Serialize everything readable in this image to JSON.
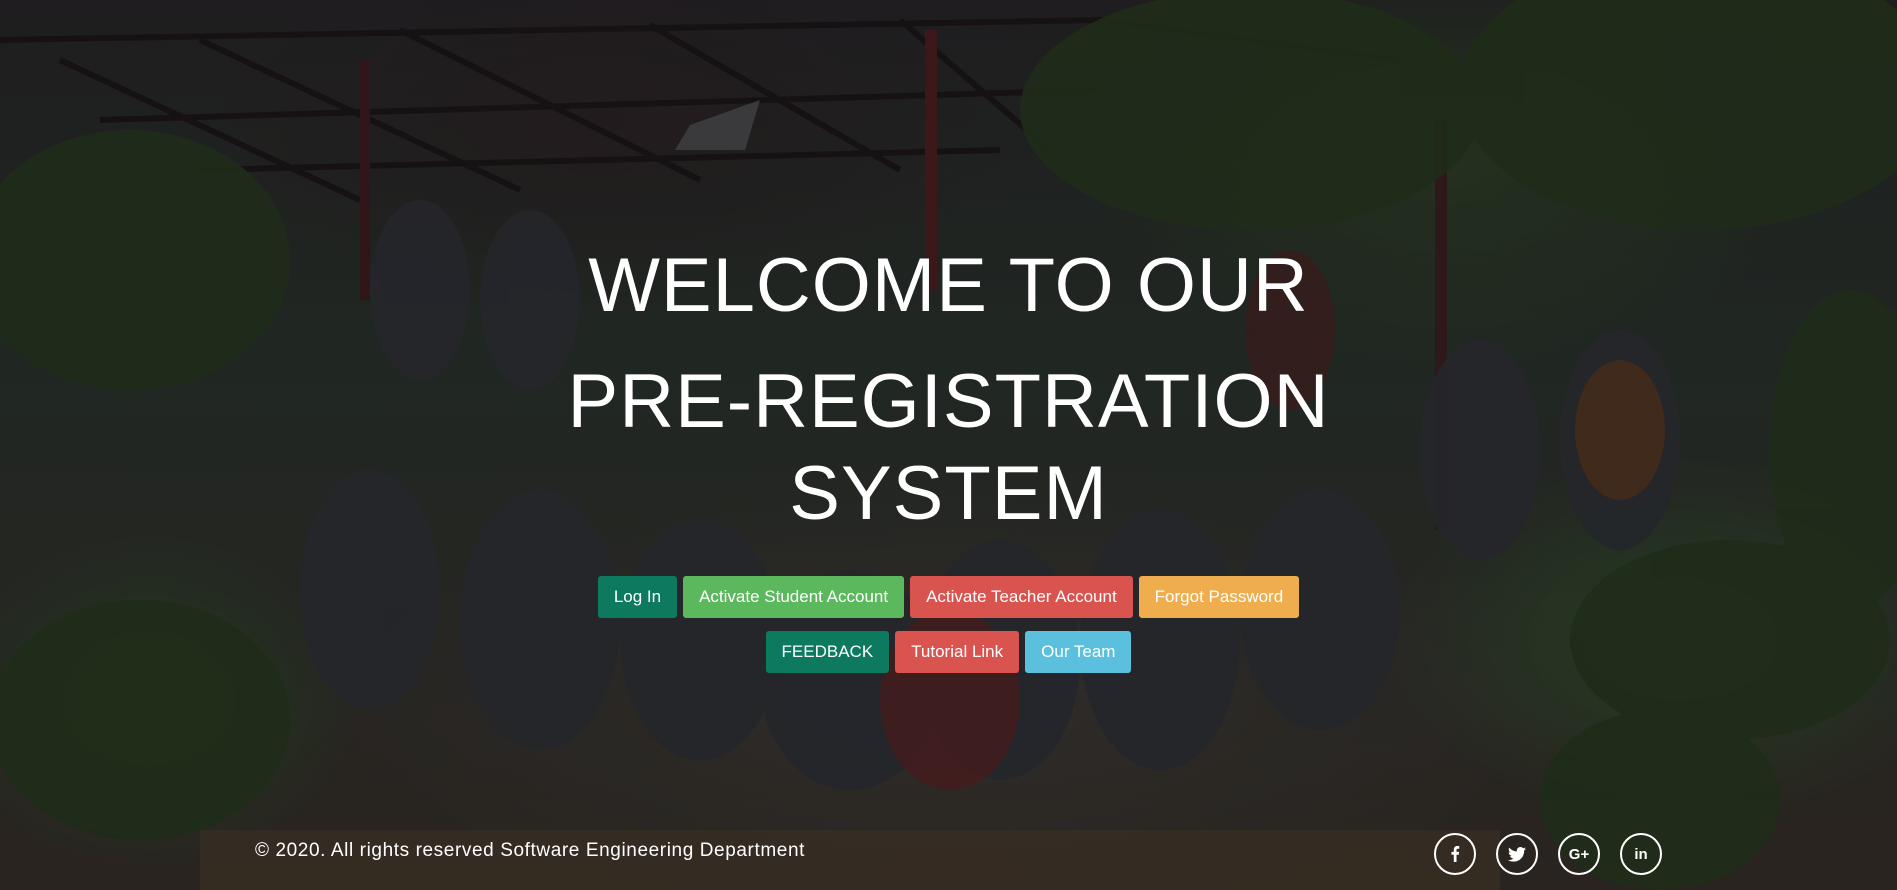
{
  "hero": {
    "line1": "WELCOME TO OUR",
    "line2": "PRE-REGISTRATION",
    "line3": "SYSTEM"
  },
  "buttons": {
    "row1": [
      {
        "label": "Log In",
        "color": "#0d7a5f"
      },
      {
        "label": "Activate Student Account",
        "color": "#5cb85c"
      },
      {
        "label": "Activate Teacher Account",
        "color": "#d9534f"
      },
      {
        "label": "Forgot Password",
        "color": "#f0ad4e"
      }
    ],
    "row2": [
      {
        "label": "FEEDBACK",
        "color": "#0d7a5f"
      },
      {
        "label": "Tutorial Link",
        "color": "#d9534f"
      },
      {
        "label": "Our Team",
        "color": "#5bc0de"
      }
    ]
  },
  "footer": {
    "copyright": "© 2020. All rights reserved Software Engineering Department",
    "social": [
      {
        "icon": "facebook-icon"
      },
      {
        "icon": "twitter-icon"
      },
      {
        "icon": "google-plus-icon",
        "text": "G+"
      },
      {
        "icon": "linkedin-icon",
        "text": "in"
      }
    ]
  }
}
